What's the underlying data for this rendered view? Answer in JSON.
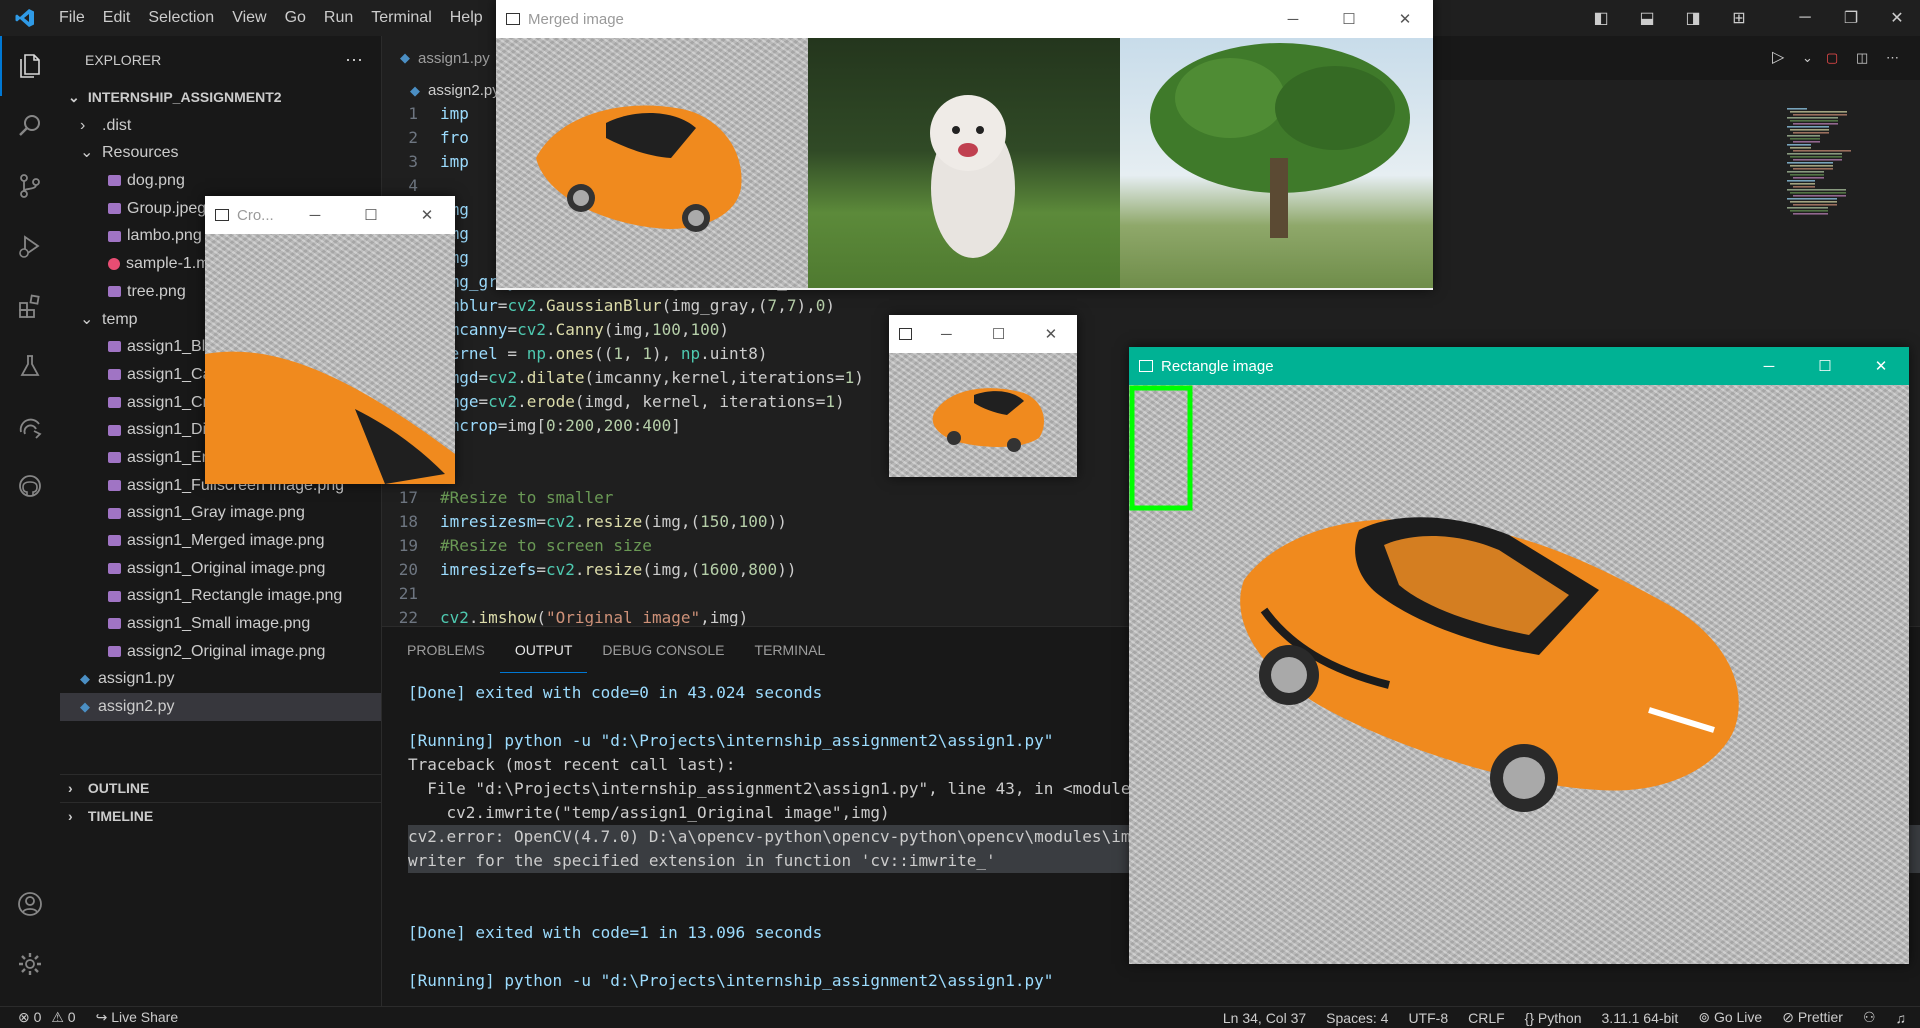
{
  "menu": [
    "File",
    "Edit",
    "Selection",
    "View",
    "Go",
    "Run",
    "Terminal",
    "Help"
  ],
  "explorer": {
    "header": "EXPLORER",
    "root": "INTERNSHIP_ASSIGNMENT2",
    "items": [
      {
        "label": ".dist",
        "type": "folder-closed",
        "depth": 1
      },
      {
        "label": "Resources",
        "type": "folder-open",
        "depth": 1
      },
      {
        "label": "dog.png",
        "type": "image",
        "depth": 2
      },
      {
        "label": "Group.jpeg.jpg",
        "type": "image",
        "depth": 2
      },
      {
        "label": "lambo.png",
        "type": "image",
        "depth": 2
      },
      {
        "label": "sample-1.mp4",
        "type": "video",
        "depth": 2
      },
      {
        "label": "tree.png",
        "type": "image",
        "depth": 2
      },
      {
        "label": "temp",
        "type": "folder-open",
        "depth": 1
      },
      {
        "label": "assign1_Blur image.png",
        "type": "image",
        "depth": 2
      },
      {
        "label": "assign1_Canny image.png",
        "type": "image",
        "depth": 2
      },
      {
        "label": "assign1_Cropped image.png",
        "type": "image",
        "depth": 2
      },
      {
        "label": "assign1_Dilated image.png",
        "type": "image",
        "depth": 2
      },
      {
        "label": "assign1_Eroded image.png",
        "type": "image",
        "depth": 2
      },
      {
        "label": "assign1_Fullscreen image.png",
        "type": "image",
        "depth": 2
      },
      {
        "label": "assign1_Gray image.png",
        "type": "image",
        "depth": 2
      },
      {
        "label": "assign1_Merged image.png",
        "type": "image",
        "depth": 2
      },
      {
        "label": "assign1_Original image.png",
        "type": "image",
        "depth": 2
      },
      {
        "label": "assign1_Rectangle image.png",
        "type": "image",
        "depth": 2
      },
      {
        "label": "assign1_Small image.png",
        "type": "image",
        "depth": 2
      },
      {
        "label": "assign2_Original image.png",
        "type": "image",
        "depth": 2
      },
      {
        "label": "assign1.py",
        "type": "python",
        "depth": 1
      },
      {
        "label": "assign2.py",
        "type": "python",
        "depth": 1,
        "selected": true
      }
    ],
    "outline": "OUTLINE",
    "timeline": "TIMELINE"
  },
  "editor": {
    "tab": "assign1.py",
    "breadcrumb": "assign2.py",
    "lines": [
      {
        "n": "1",
        "html": "imp"
      },
      {
        "n": "2",
        "html": "fro"
      },
      {
        "n": "3",
        "html": "imp"
      },
      {
        "n": "4",
        "html": ""
      },
      {
        "n": "5",
        "html": "img"
      },
      {
        "n": "6",
        "html": "img"
      },
      {
        "n": "7",
        "html": "img"
      },
      {
        "n": "8",
        "html": "img_gray=cv2.cvtColor(img,cv2.COLOR_BGR2GRAY)"
      },
      {
        "n": "9",
        "html": "imblur=cv2.GaussianBlur(img_gray,(7,7),0)"
      },
      {
        "n": "10",
        "html": "imcanny=cv2.Canny(img,100,100)"
      },
      {
        "n": "11",
        "html": "kernel = np.ones((1, 1), np.uint8)"
      },
      {
        "n": "12",
        "html": "imgd=cv2.dilate(imcanny,kernel,iterations=1)"
      },
      {
        "n": "13",
        "html": "imge=cv2.erode(imgd, kernel, iterations=1)"
      },
      {
        "n": "14",
        "html": "imcrop=img[0:200,200:400]"
      },
      {
        "n": "15",
        "html": ""
      },
      {
        "n": "16",
        "html": ""
      },
      {
        "n": "17",
        "html": "#Resize to smaller"
      },
      {
        "n": "18",
        "html": "imresizesm=cv2.resize(img,(150,100))"
      },
      {
        "n": "19",
        "html": "#Resize to screen size"
      },
      {
        "n": "20",
        "html": "imresizefs=cv2.resize(img,(1600,800))"
      },
      {
        "n": "21",
        "html": ""
      },
      {
        "n": "22",
        "html": "cv2.imshow(\"Original image\",img)"
      }
    ]
  },
  "panel": {
    "tabs": [
      "PROBLEMS",
      "OUTPUT",
      "DEBUG CONSOLE",
      "TERMINAL"
    ],
    "active_tab": "OUTPUT",
    "output": [
      "[Done] exited with code=0 in 43.024 seconds",
      "",
      "[Running] python -u \"d:\\Projects\\internship_assignment2\\assign1.py\"",
      "Traceback (most recent call last):",
      "  File \"d:\\Projects\\internship_assignment2\\assign1.py\", line 43, in <module>",
      "    cv2.imwrite(\"temp/assign1_Original image\",img)",
      "cv2.error: OpenCV(4.7.0) D:\\a\\opencv-python\\opencv-python\\opencv\\modules\\imgcodecs\\src\\loadsave.cpp",
      "writer for the specified extension in function 'cv::imwrite_'",
      "",
      "",
      "[Done] exited with code=1 in 13.096 seconds",
      "",
      "[Running] python -u \"d:\\Projects\\internship_assignment2\\assign1.py\""
    ]
  },
  "status": {
    "errors": "0",
    "warnings": "0",
    "live_share": "Live Share",
    "position": "Ln 34, Col 37",
    "spaces": "Spaces: 4",
    "encoding": "UTF-8",
    "eol": "CRLF",
    "language": "Python",
    "interpreter": "3.11.1 64-bit",
    "go_live": "Go Live",
    "prettier": "Prettier"
  },
  "windows": {
    "merged": "Merged image",
    "cropped": "Cro...",
    "small": "",
    "rectangle": "Rectangle image"
  },
  "colors": {
    "rect_title_bg": "#00b294",
    "box_green": "#00ff00",
    "car_orange": "#f08a1e"
  }
}
